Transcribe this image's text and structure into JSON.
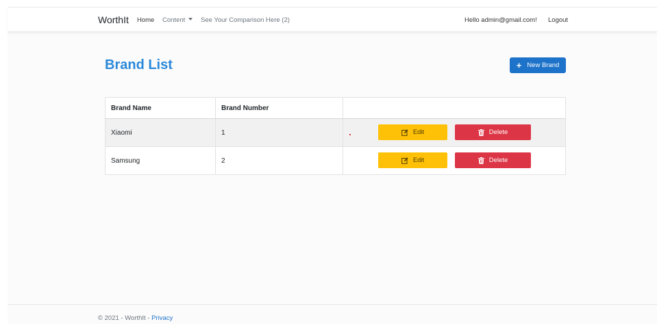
{
  "navbar": {
    "brand": "WorthIt",
    "home": "Home",
    "content": "Content",
    "comparison": "See Your Comparison Here (2)",
    "greeting": "Hello admin@gmail.com!",
    "logout": "Logout"
  },
  "main": {
    "title": "Brand List",
    "new_button": "New Brand",
    "table": {
      "headers": [
        "Brand Name",
        "Brand Number",
        ""
      ],
      "rows": [
        {
          "name": "Xiaomi",
          "number": "1"
        },
        {
          "name": "Samsung",
          "number": "2"
        }
      ],
      "edit_label": "Edit",
      "delete_label": "Delete"
    }
  },
  "footer": {
    "text": "© 2021 - WorthIt - ",
    "privacy": "Privacy"
  },
  "colors": {
    "title": "#2b88d9",
    "primary": "#1d72c9",
    "warning": "#ffc107",
    "danger": "#dc3545"
  }
}
